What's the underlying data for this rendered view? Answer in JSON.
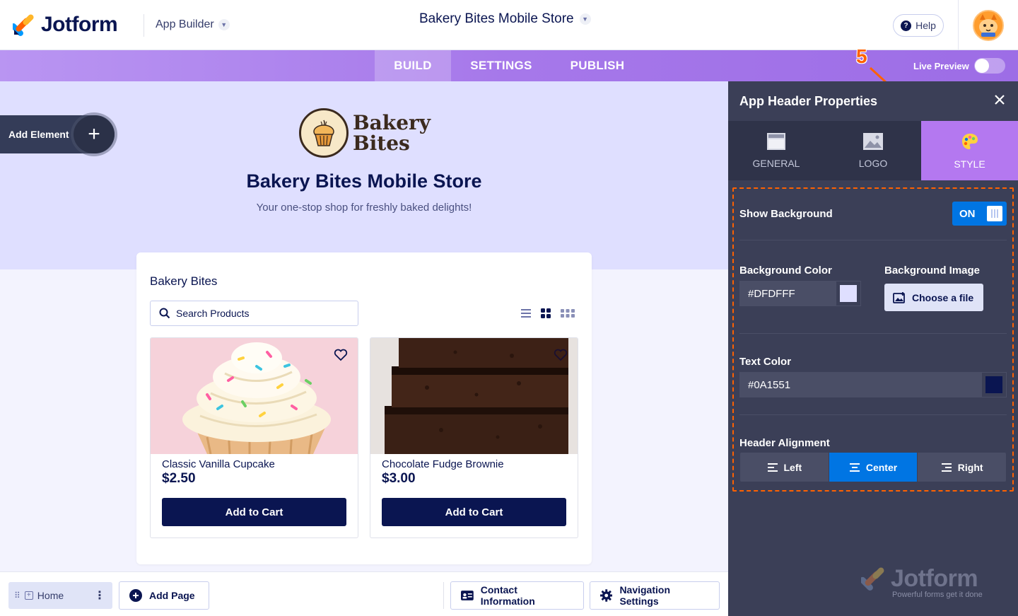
{
  "topbar": {
    "logo_text": "Jotform",
    "app_builder_label": "App Builder",
    "app_title": "Bakery Bites Mobile Store",
    "help_label": "Help"
  },
  "nav": {
    "tabs": [
      {
        "label": "BUILD",
        "active": true
      },
      {
        "label": "SETTINGS",
        "active": false
      },
      {
        "label": "PUBLISH",
        "active": false
      }
    ],
    "live_preview_label": "Live Preview",
    "live_preview_on": false,
    "step_marker": "5"
  },
  "canvas": {
    "add_element_label": "Add Element",
    "brand_line1": "Bakery",
    "brand_line2": "Bites",
    "header_title": "Bakery Bites Mobile Store",
    "header_subtitle": "Your one-stop shop for freshly baked delights!",
    "header_bg_color": "#DFDFFF",
    "product_list": {
      "title": "Bakery Bites",
      "search_placeholder": "Search Products",
      "products": [
        {
          "name": "Classic Vanilla Cupcake",
          "price": "$2.50",
          "button": "Add to Cart"
        },
        {
          "name": "Chocolate Fudge Brownie",
          "price": "$3.00",
          "button": "Add to Cart"
        }
      ]
    }
  },
  "bottombar": {
    "home_label": "Home",
    "add_page_label": "Add Page",
    "contact_info_label": "Contact Information",
    "nav_settings_label": "Navigation Settings"
  },
  "panel": {
    "title": "App Header Properties",
    "tabs": [
      {
        "label": "GENERAL",
        "icon": "layout-icon",
        "active": false
      },
      {
        "label": "LOGO",
        "icon": "image-icon",
        "active": false
      },
      {
        "label": "STYLE",
        "icon": "palette-icon",
        "active": true
      }
    ],
    "show_background_label": "Show Background",
    "show_background_value": "ON",
    "background_color_label": "Background Color",
    "background_color_value": "#DFDFFF",
    "background_image_label": "Background Image",
    "choose_file_label": "Choose a file",
    "text_color_label": "Text Color",
    "text_color_value": "#0A1551",
    "header_alignment_label": "Header Alignment",
    "alignment_options": [
      {
        "label": "Left",
        "active": false
      },
      {
        "label": "Center",
        "active": true
      },
      {
        "label": "Right",
        "active": false
      }
    ],
    "watermark_text": "Jotform",
    "watermark_sub": "Powerful forms get it done"
  },
  "colors": {
    "navy": "#0A1551",
    "accent_blue": "#0075E3",
    "purple": "#A678EA",
    "highlight_orange": "#FF6100"
  }
}
